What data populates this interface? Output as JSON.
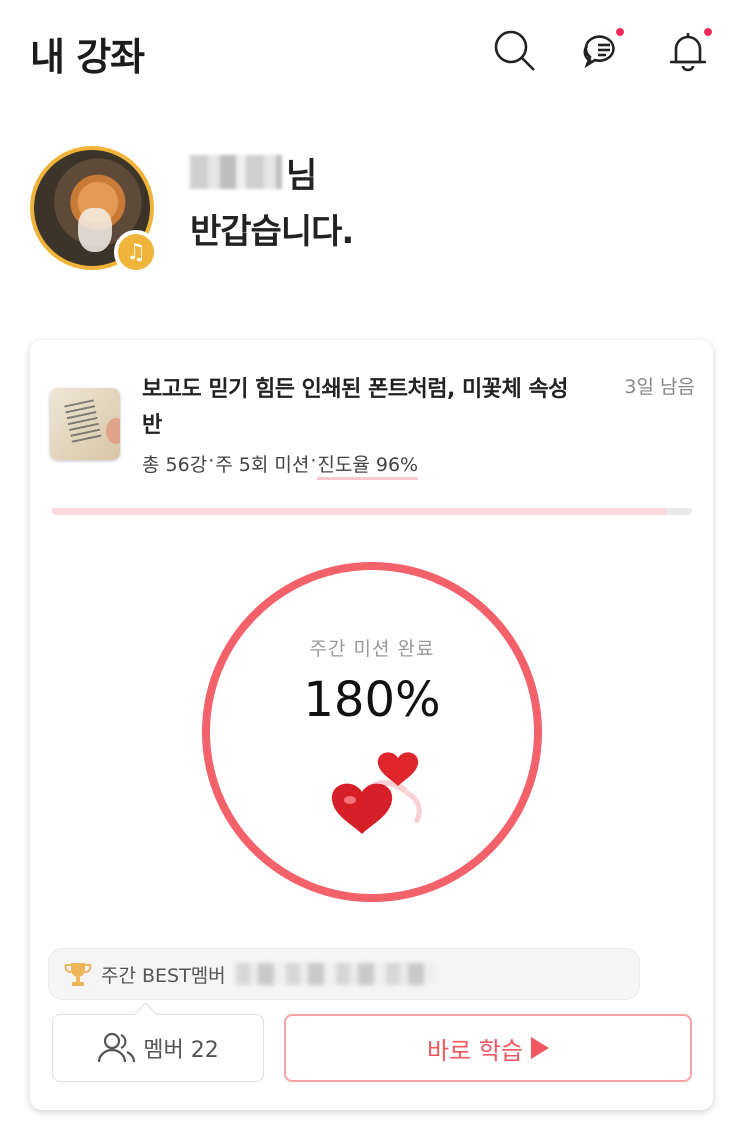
{
  "header": {
    "title": "내 강좌",
    "icons": [
      "search-icon",
      "chat-icon",
      "bell-icon"
    ],
    "notification_color": "#ee2d58"
  },
  "greeting": {
    "name_suffix": "님",
    "message": "반갑습니다."
  },
  "course": {
    "title": "보고도 믿기 힘든 인쇄된 폰트처럼, 미꽃체 속성반",
    "days_left": "3일 남음",
    "total_lessons": "총 56강",
    "missions": "주 5회 미션",
    "progress_text": "진도율 96%",
    "progress_fraction": 0.96,
    "separator": "·"
  },
  "weekly": {
    "label": "주간 미션 완료",
    "value": "180%",
    "ring_color": "#f3616a"
  },
  "best": {
    "label": "주간 BEST멤버"
  },
  "actions": {
    "member_label": "멤버 22",
    "study_label": "바로 학습"
  }
}
